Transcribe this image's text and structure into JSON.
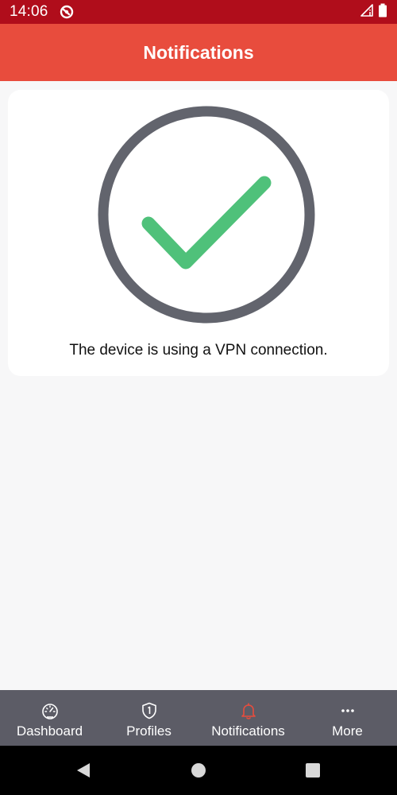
{
  "status_bar": {
    "time": "14:06",
    "app_icon": "vpn-app-icon",
    "signal_icon": "signal-icon",
    "battery_icon": "battery-icon"
  },
  "app_bar": {
    "title": "Notifications"
  },
  "card": {
    "status_icon": "check-circle-icon",
    "message": "The device is using a VPN connection."
  },
  "bottom_nav": {
    "items": [
      {
        "label": "Dashboard",
        "icon": "gauge-icon"
      },
      {
        "label": "Profiles",
        "icon": "shield-icon"
      },
      {
        "label": "Notifications",
        "icon": "bell-icon",
        "active": true
      },
      {
        "label": "More",
        "icon": "more-dots-icon"
      }
    ]
  },
  "system_nav": {
    "back_icon": "back-triangle-icon",
    "home_icon": "home-circle-icon",
    "recents_icon": "recents-square-icon"
  },
  "colors": {
    "status_bar": "#b00d1b",
    "app_bar": "#e84c3d",
    "bottom_nav": "#5c5c66",
    "check": "#4fc17a",
    "ring": "#62646d",
    "active_icon": "#e84c3d"
  }
}
